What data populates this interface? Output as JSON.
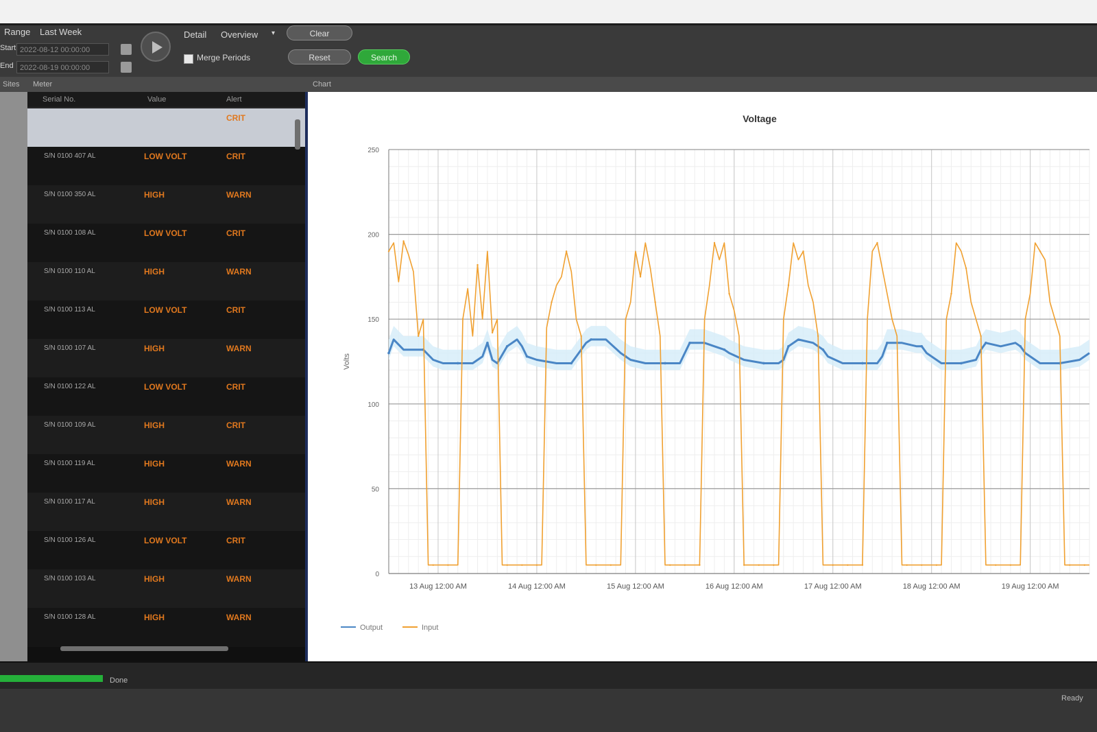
{
  "toolbar": {
    "range_label": "Range",
    "last_week_label": "Last Week",
    "start_label": "Start",
    "end_label": "End",
    "start_value": "2022-08-12 00:00:00",
    "end_value": "2022-08-19 00:00:00",
    "detail_label": "Detail",
    "detail_select": "Overview",
    "merge_label": "Merge Periods",
    "btn_top": "Clear",
    "btn_mid": "Reset",
    "btn_green": "Search"
  },
  "panels": {
    "left_label": "Sites",
    "list_label": "Meter",
    "chart_label": "Chart"
  },
  "list": {
    "headers": [
      "Serial No.",
      "Value",
      "Alert"
    ],
    "rows": [
      {
        "id": "",
        "v1": "",
        "v2": "CRIT"
      },
      {
        "id": "S/N 0100 407 AL",
        "v1": "LOW VOLT",
        "v2": "CRIT"
      },
      {
        "id": "S/N 0100 350 AL",
        "v1": "HIGH",
        "v2": "WARN"
      },
      {
        "id": "S/N 0100 108 AL",
        "v1": "LOW VOLT",
        "v2": "CRIT"
      },
      {
        "id": "S/N 0100 110 AL",
        "v1": "HIGH",
        "v2": "WARN"
      },
      {
        "id": "S/N 0100 113 AL",
        "v1": "LOW VOLT",
        "v2": "CRIT"
      },
      {
        "id": "S/N 0100 107 AL",
        "v1": "HIGH",
        "v2": "WARN"
      },
      {
        "id": "S/N 0100 122 AL",
        "v1": "LOW VOLT",
        "v2": "CRIT"
      },
      {
        "id": "S/N 0100 109 AL",
        "v1": "HIGH",
        "v2": "CRIT"
      },
      {
        "id": "S/N 0100 119 AL",
        "v1": "HIGH",
        "v2": "WARN"
      },
      {
        "id": "S/N 0100 117 AL",
        "v1": "HIGH",
        "v2": "WARN"
      },
      {
        "id": "S/N 0100 126 AL",
        "v1": "LOW VOLT",
        "v2": "CRIT"
      },
      {
        "id": "S/N 0100 103 AL",
        "v1": "HIGH",
        "v2": "WARN"
      },
      {
        "id": "S/N 0100 128 AL",
        "v1": "HIGH",
        "v2": "WARN"
      }
    ]
  },
  "status": {
    "progress_label": "Done",
    "progress_value": 1.0,
    "right_text": "Ready"
  },
  "colors": {
    "series_blue": "#4a86c5",
    "series_orange": "#f0a030",
    "accent_green": "#2fa83a",
    "list_text": "#e0781e"
  },
  "chart_data": {
    "type": "line",
    "title": "Voltage",
    "xlabel": "",
    "ylabel": "Volts",
    "ylim": [
      0,
      250
    ],
    "yticks": [
      0,
      50,
      100,
      150,
      200,
      250
    ],
    "xlim": [
      0,
      7.1
    ],
    "xticks": [
      {
        "x": 0.5,
        "label": "13 Aug 12:00 AM"
      },
      {
        "x": 1.5,
        "label": "14 Aug 12:00 AM"
      },
      {
        "x": 2.5,
        "label": "15 Aug 12:00 AM"
      },
      {
        "x": 3.5,
        "label": "16 Aug 12:00 AM"
      },
      {
        "x": 4.5,
        "label": "17 Aug 12:00 AM"
      },
      {
        "x": 5.5,
        "label": "18 Aug 12:00 AM"
      },
      {
        "x": 6.5,
        "label": "19 Aug 12:00 AM"
      }
    ],
    "grid": true,
    "legend_position": "bottom-left",
    "series": [
      {
        "name": "Output",
        "color": "#4a86c5",
        "x": [
          0.0,
          0.05,
          0.15,
          0.35,
          0.45,
          0.55,
          0.7,
          0.85,
          0.95,
          1.0,
          1.05,
          1.1,
          1.2,
          1.3,
          1.35,
          1.4,
          1.5,
          1.7,
          1.85,
          1.9,
          2.0,
          2.05,
          2.2,
          2.35,
          2.4,
          2.45,
          2.6,
          2.8,
          2.95,
          3.0,
          3.05,
          3.2,
          3.3,
          3.4,
          3.45,
          3.6,
          3.8,
          3.95,
          4.0,
          4.05,
          4.15,
          4.3,
          4.4,
          4.45,
          4.6,
          4.8,
          4.95,
          5.0,
          5.05,
          5.2,
          5.35,
          5.4,
          5.45,
          5.6,
          5.8,
          5.95,
          6.0,
          6.05,
          6.2,
          6.35,
          6.4,
          6.45,
          6.6,
          6.8,
          7.0,
          7.1
        ],
        "y": [
          130,
          138,
          132,
          132,
          126,
          124,
          124,
          124,
          128,
          136,
          126,
          124,
          134,
          138,
          134,
          128,
          126,
          124,
          124,
          128,
          136,
          138,
          138,
          130,
          128,
          126,
          124,
          124,
          124,
          130,
          136,
          136,
          134,
          132,
          130,
          126,
          124,
          124,
          126,
          134,
          138,
          136,
          132,
          128,
          124,
          124,
          124,
          128,
          136,
          136,
          134,
          134,
          130,
          124,
          124,
          126,
          132,
          136,
          134,
          136,
          134,
          130,
          124,
          124,
          126,
          130
        ]
      },
      {
        "name": "Input",
        "color": "#f0a030",
        "x": [
          0.0,
          0.05,
          0.1,
          0.15,
          0.2,
          0.25,
          0.3,
          0.35,
          0.4,
          0.45,
          0.5,
          0.55,
          0.6,
          0.65,
          0.7,
          0.75,
          0.8,
          0.85,
          0.9,
          0.95,
          1.0,
          1.05,
          1.1,
          1.15,
          1.2,
          1.25,
          1.3,
          1.35,
          1.4,
          1.45,
          1.5,
          1.55,
          1.6,
          1.65,
          1.7,
          1.75,
          1.8,
          1.85,
          1.9,
          1.95,
          2.0,
          2.05,
          2.1,
          2.15,
          2.2,
          2.25,
          2.3,
          2.35,
          2.4,
          2.45,
          2.5,
          2.55,
          2.6,
          2.65,
          2.7,
          2.75,
          2.8,
          2.85,
          2.9,
          2.95,
          3.0,
          3.05,
          3.1,
          3.15,
          3.2,
          3.25,
          3.3,
          3.35,
          3.4,
          3.45,
          3.5,
          3.55,
          3.6,
          3.65,
          3.7,
          3.75,
          3.8,
          3.85,
          3.9,
          3.95,
          4.0,
          4.05,
          4.1,
          4.15,
          4.2,
          4.25,
          4.3,
          4.35,
          4.4,
          4.45,
          4.5,
          4.55,
          4.6,
          4.65,
          4.7,
          4.75,
          4.8,
          4.85,
          4.9,
          4.95,
          5.0,
          5.05,
          5.1,
          5.15,
          5.2,
          5.25,
          5.3,
          5.35,
          5.4,
          5.45,
          5.5,
          5.55,
          5.6,
          5.65,
          5.7,
          5.75,
          5.8,
          5.85,
          5.9,
          5.95,
          6.0,
          6.05,
          6.1,
          6.15,
          6.2,
          6.25,
          6.3,
          6.35,
          6.4,
          6.45,
          6.5,
          6.55,
          6.6,
          6.65,
          6.7,
          6.75,
          6.8,
          6.85,
          6.9,
          6.95,
          7.0,
          7.05,
          7.1
        ],
        "y": [
          190,
          195,
          172,
          196,
          188,
          178,
          140,
          150,
          5,
          5,
          5,
          5,
          5,
          5,
          5,
          150,
          168,
          140,
          182,
          150,
          190,
          142,
          150,
          5,
          5,
          5,
          5,
          5,
          5,
          5,
          5,
          5,
          145,
          160,
          170,
          175,
          190,
          178,
          150,
          140,
          5,
          5,
          5,
          5,
          5,
          5,
          5,
          5,
          150,
          160,
          190,
          175,
          195,
          180,
          160,
          140,
          5,
          5,
          5,
          5,
          5,
          5,
          5,
          5,
          150,
          170,
          195,
          185,
          195,
          165,
          155,
          140,
          5,
          5,
          5,
          5,
          5,
          5,
          5,
          5,
          150,
          170,
          195,
          185,
          190,
          170,
          160,
          140,
          5,
          5,
          5,
          5,
          5,
          5,
          5,
          5,
          5,
          150,
          190,
          195,
          180,
          165,
          150,
          140,
          5,
          5,
          5,
          5,
          5,
          5,
          5,
          5,
          5,
          150,
          165,
          195,
          190,
          180,
          160,
          150,
          140,
          5,
          5,
          5,
          5,
          5,
          5,
          5,
          5,
          150,
          165,
          195,
          190,
          185,
          160,
          150,
          140,
          5,
          5,
          5,
          5,
          5,
          5
        ]
      }
    ]
  }
}
